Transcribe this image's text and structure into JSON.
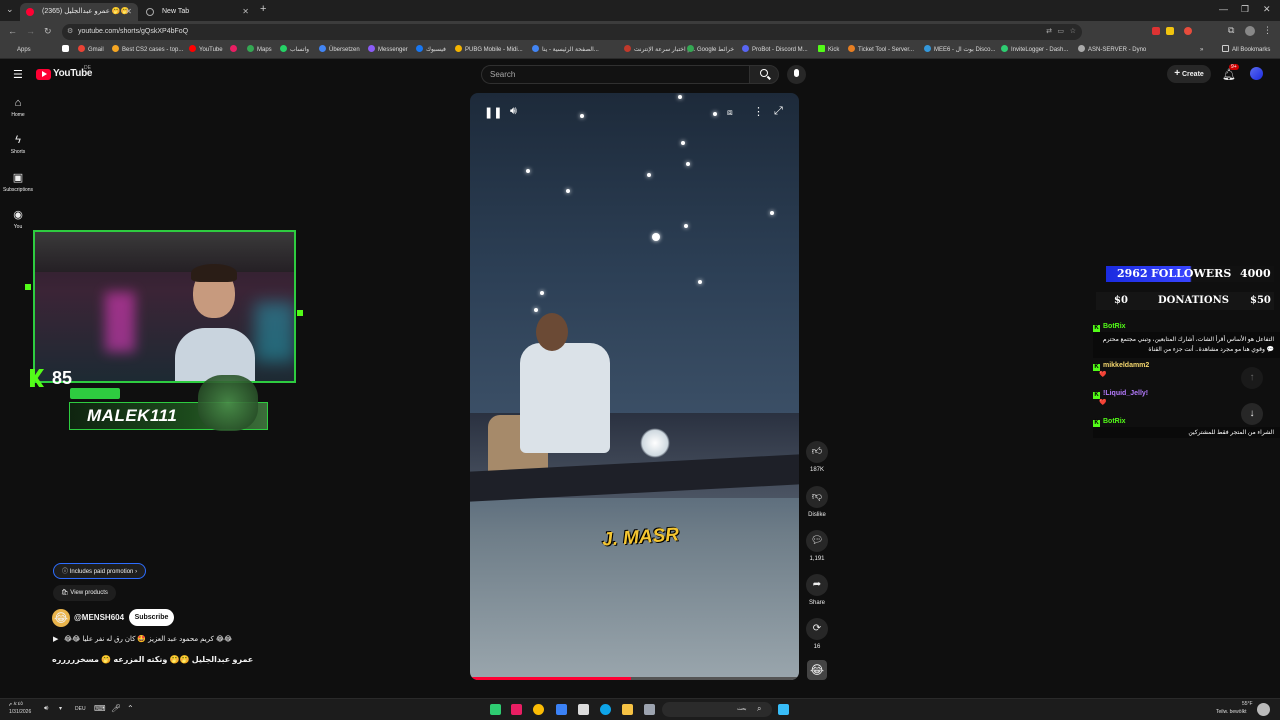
{
  "browser": {
    "tabs": [
      {
        "label": "عمرو عبدالجليل (2365) 🤭🤭",
        "active": true
      },
      {
        "label": "New Tab",
        "active": false
      }
    ],
    "url": "youtube.com/shorts/gQskXP4bFoQ",
    "bookmarks": [
      {
        "label": "Apps",
        "color": "#888"
      },
      {
        "label": "Gmail",
        "color": "#ea4335"
      },
      {
        "label": "Best CS2 cases - top...",
        "color": "#f5a623"
      },
      {
        "label": "YouTube",
        "color": "#ff0000"
      },
      {
        "label": "Maps",
        "color": "#34a853"
      },
      {
        "label": "واتساب",
        "color": "#25d366"
      },
      {
        "label": "Übersetzen",
        "color": "#4285f4"
      },
      {
        "label": "Messenger",
        "color": "#8b5cf6"
      },
      {
        "label": "فيسبوك",
        "color": "#1877f2"
      },
      {
        "label": "PUBG Mobile - Midi...",
        "color": "#f4b400"
      },
      {
        "label": "الصفحة الرئيسية - ينا...",
        "color": "#4285f4"
      },
      {
        "label": "اختبار سرعة الإنترنت | ...",
        "color": "#c0392b"
      },
      {
        "label": "Google خرائط",
        "color": "#34a853"
      },
      {
        "label": "ProBot - Discord M...",
        "color": "#5865f2"
      },
      {
        "label": "Kick",
        "color": "#53fc18"
      },
      {
        "label": "Ticket Tool - Server...",
        "color": "#e67e22"
      },
      {
        "label": "MEE6 - بوت ال Disco...",
        "color": "#3498db"
      },
      {
        "label": "InviteLogger - Dash...",
        "color": "#2ecc71"
      },
      {
        "label": "ASN-SERVER - Dyno",
        "color": "#aaa"
      }
    ],
    "all_bookmarks": "All Bookmarks"
  },
  "youtube": {
    "logo": "YouTube",
    "region": "DE",
    "search_placeholder": "Search",
    "create_label": "Create",
    "notif_count": "9+",
    "sidebar": [
      {
        "label": "Home",
        "icon": "home-icon"
      },
      {
        "label": "Shorts",
        "icon": "shorts-icon"
      },
      {
        "label": "Subscriptions",
        "icon": "subscriptions-icon"
      },
      {
        "label": "You",
        "icon": "you-icon"
      }
    ],
    "actions": {
      "likes": "187K",
      "dislike": "Dislike",
      "comments": "1,191",
      "share": "Share",
      "remix": "16"
    },
    "video_watermark": "J. MASR",
    "paid_promotion": "Includes paid promotion",
    "view_products": "View products",
    "channel": "@MENSH604",
    "subscribe": "Subscribe",
    "description_line1": "😂😂 كريم محمود عبد العزيز 🤩 كان رق له نفر عليا 😂😂",
    "description_line2": "عمرو عبدالجليل 🤭🤭 ونكته المزرعه 🤭 مسخررررره"
  },
  "stream_overlay": {
    "kick_viewers": "85",
    "streamer_name": "MALEK111",
    "followers_current": "2962",
    "followers_label": "FOLLOWERS",
    "followers_goal": "4000",
    "donations_current": "$0",
    "donations_label": "DONATIONS",
    "donations_goal": "$50",
    "chat": [
      {
        "user": "BotRix",
        "color": "#53fc18",
        "msg": "التفاعل هو الأساس أقرأ الشات، أشارك المتابعين، وتبني مجتمع محترم 💬 وقوي هنا مو مجرد مشاهدة.. أنت جزء من القناة"
      },
      {
        "user": "mikkeldamm2",
        "color": "#f5d76e",
        "msg": "❤️"
      },
      {
        "user": "!Liquid_Jelly!",
        "color": "#b57bff",
        "msg": "❤️"
      },
      {
        "user": "BotRix",
        "color": "#53fc18",
        "msg": "الشراء من المتجر فقط للمشتركين"
      }
    ]
  },
  "taskbar": {
    "time": "٨:٤٥ م",
    "date": "1/31/2026",
    "lang": "DEU",
    "search_placeholder": "بحث",
    "weather": "55°F",
    "weather_desc": "Teilw. bewölkt"
  }
}
